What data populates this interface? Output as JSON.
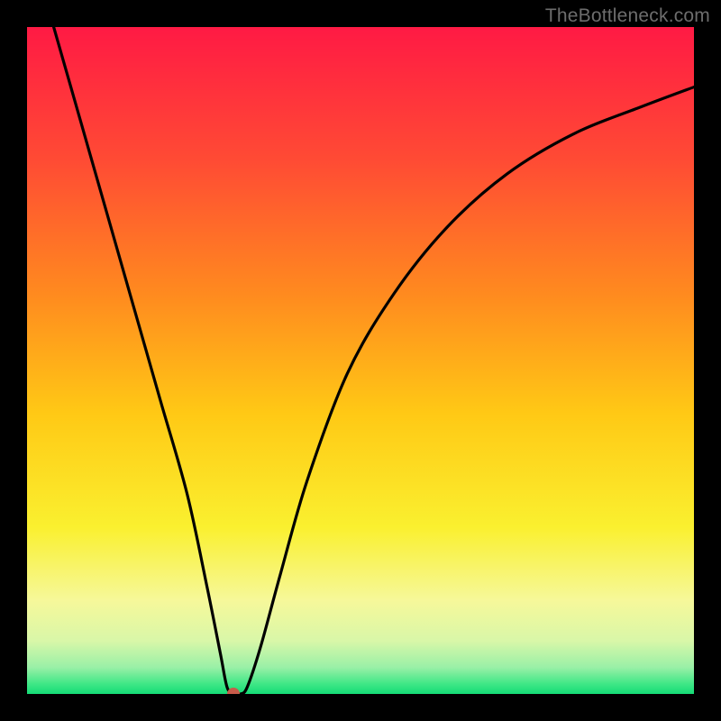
{
  "watermark": "TheBottleneck.com",
  "chart_data": {
    "type": "line",
    "title": "",
    "xlabel": "",
    "ylabel": "",
    "xlim": [
      0,
      100
    ],
    "ylim": [
      0,
      100
    ],
    "series": [
      {
        "name": "bottleneck-curve",
        "x": [
          4,
          8,
          12,
          16,
          20,
          24,
          27,
          29,
          30,
          31,
          32,
          33,
          35,
          38,
          42,
          48,
          55,
          63,
          72,
          82,
          92,
          100
        ],
        "values": [
          100,
          86,
          72,
          58,
          44,
          30,
          16,
          6,
          1,
          0,
          0,
          1,
          7,
          18,
          32,
          48,
          60,
          70,
          78,
          84,
          88,
          91
        ]
      }
    ],
    "marker": {
      "x": 31,
      "y": 0,
      "color": "#c75b4a",
      "radius_px": 7
    },
    "background_gradient_stops": [
      {
        "pos": 0.0,
        "color": "#ff1a44"
      },
      {
        "pos": 0.2,
        "color": "#ff4b34"
      },
      {
        "pos": 0.4,
        "color": "#ff8a1f"
      },
      {
        "pos": 0.58,
        "color": "#ffc915"
      },
      {
        "pos": 0.75,
        "color": "#faf02f"
      },
      {
        "pos": 0.86,
        "color": "#f6f89a"
      },
      {
        "pos": 0.92,
        "color": "#d9f7a8"
      },
      {
        "pos": 0.96,
        "color": "#9af0a7"
      },
      {
        "pos": 0.985,
        "color": "#3fe786"
      },
      {
        "pos": 1.0,
        "color": "#14db76"
      }
    ]
  }
}
